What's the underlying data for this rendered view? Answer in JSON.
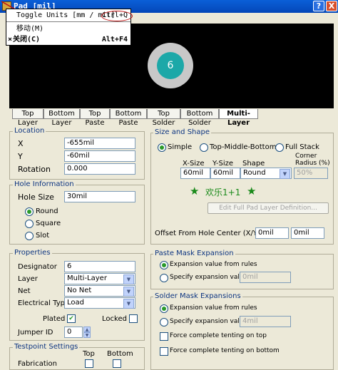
{
  "window": {
    "title": "Pad [mil]",
    "help_label": "?",
    "close_label": "X"
  },
  "menu": {
    "items": [
      {
        "label": "Toggle Units [mm / mil]",
        "shortcut": "Ctrl+Q"
      },
      {
        "label": "移动(M)",
        "shortcut": ""
      },
      {
        "label": "关闭(C)",
        "shortcut": "Alt+F4",
        "icon": "×"
      }
    ]
  },
  "preview": {
    "pad_label": "6"
  },
  "tabs": [
    "Top Layer",
    "Bottom Layer",
    "Top Paste",
    "Bottom Paste",
    "Top Solder",
    "Bottom Solder",
    "Multi-Layer"
  ],
  "active_tab": "Multi-Layer",
  "location": {
    "title": "Location",
    "x_label": "X",
    "x_value": "-655mil",
    "y_label": "Y",
    "y_value": "-60mil",
    "rotation_label": "Rotation",
    "rotation_value": "0.000"
  },
  "hole": {
    "title": "Hole Information",
    "size_label": "Hole Size",
    "size_value": "30mil",
    "options": [
      "Round",
      "Square",
      "Slot"
    ],
    "selected": "Round"
  },
  "properties": {
    "title": "Properties",
    "designator_label": "Designator",
    "designator_value": "6",
    "layer_label": "Layer",
    "layer_value": "Multi-Layer",
    "net_label": "Net",
    "net_value": "No Net",
    "etype_label": "Electrical Type",
    "etype_value": "Load",
    "plated_label": "Plated",
    "plated_checked": true,
    "locked_label": "Locked",
    "locked_checked": false,
    "jumper_label": "Jumper ID",
    "jumper_value": "0"
  },
  "testpoint": {
    "title": "Testpoint Settings",
    "top_label": "Top",
    "bottom_label": "Bottom",
    "fabrication_label": "Fabrication"
  },
  "size_shape": {
    "title": "Size and Shape",
    "options": [
      "Simple",
      "Top-Middle-Bottom",
      "Full Stack"
    ],
    "selected": "Simple",
    "col_xsize": "X-Size",
    "col_ysize": "Y-Size",
    "col_shape": "Shape",
    "col_corner": "Corner Radius (%)",
    "xsize": "60mil",
    "ysize": "60mil",
    "shape": "Round",
    "corner": "50%",
    "overlay_text": "欢乐1+1",
    "edit_button": "Edit Full Pad Layer Definition...",
    "offset_label": "Offset From Hole Center (X/Y)",
    "offset_x": "0mil",
    "offset_y": "0mil"
  },
  "paste_mask": {
    "title": "Paste Mask Expansion",
    "opt_rules": "Expansion value from rules",
    "opt_specify": "Specify expansion value",
    "value": "0mil"
  },
  "solder_mask": {
    "title": "Solder Mask Expansions",
    "opt_rules": "Expansion value from rules",
    "opt_specify": "Specify expansion value",
    "value": "4mil",
    "tent_top": "Force complete tenting on top",
    "tent_bottom": "Force complete tenting on bottom"
  }
}
